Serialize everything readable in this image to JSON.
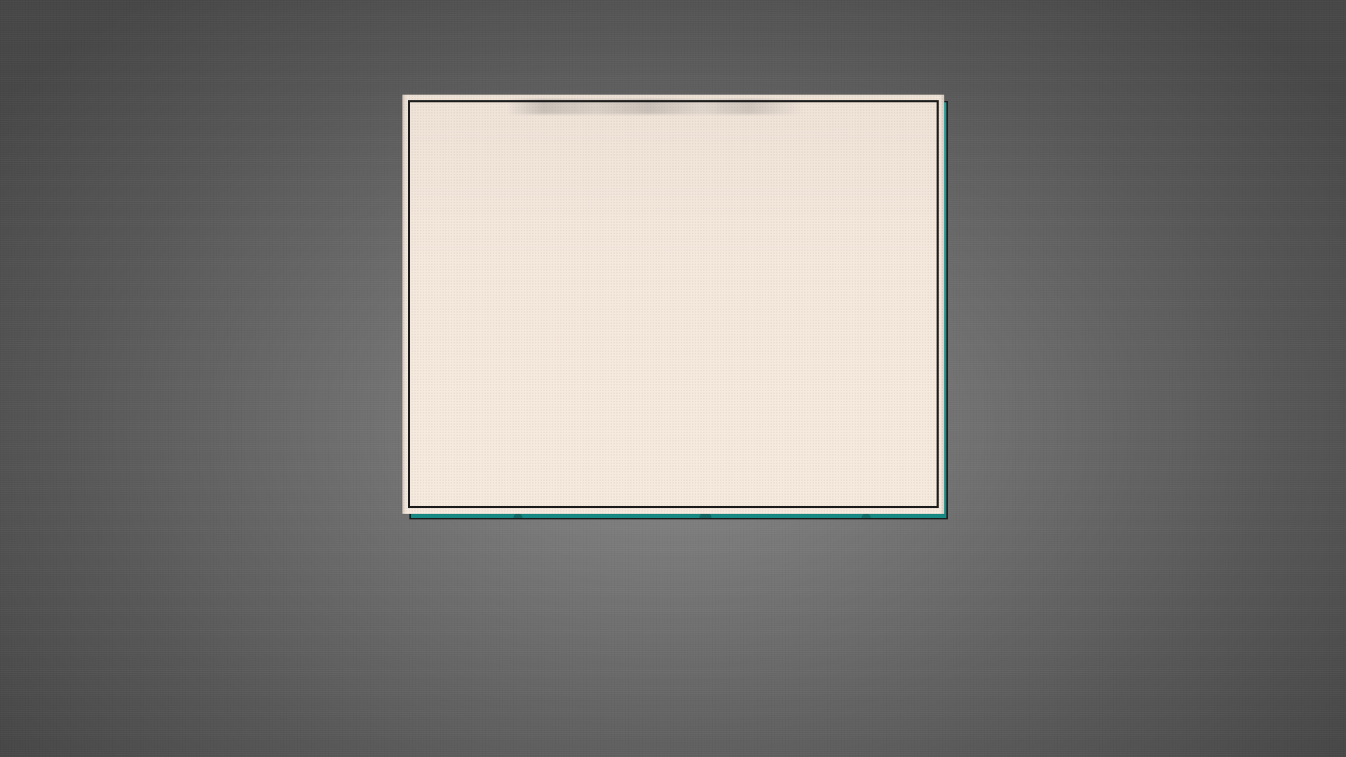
{
  "screen": {
    "background_color": "#6f6f6f",
    "card_color": "#f4e7dc",
    "card_shadow_color": "#1a8f8a",
    "border_color": "#1b1b1b"
  },
  "card": {
    "content": ""
  }
}
